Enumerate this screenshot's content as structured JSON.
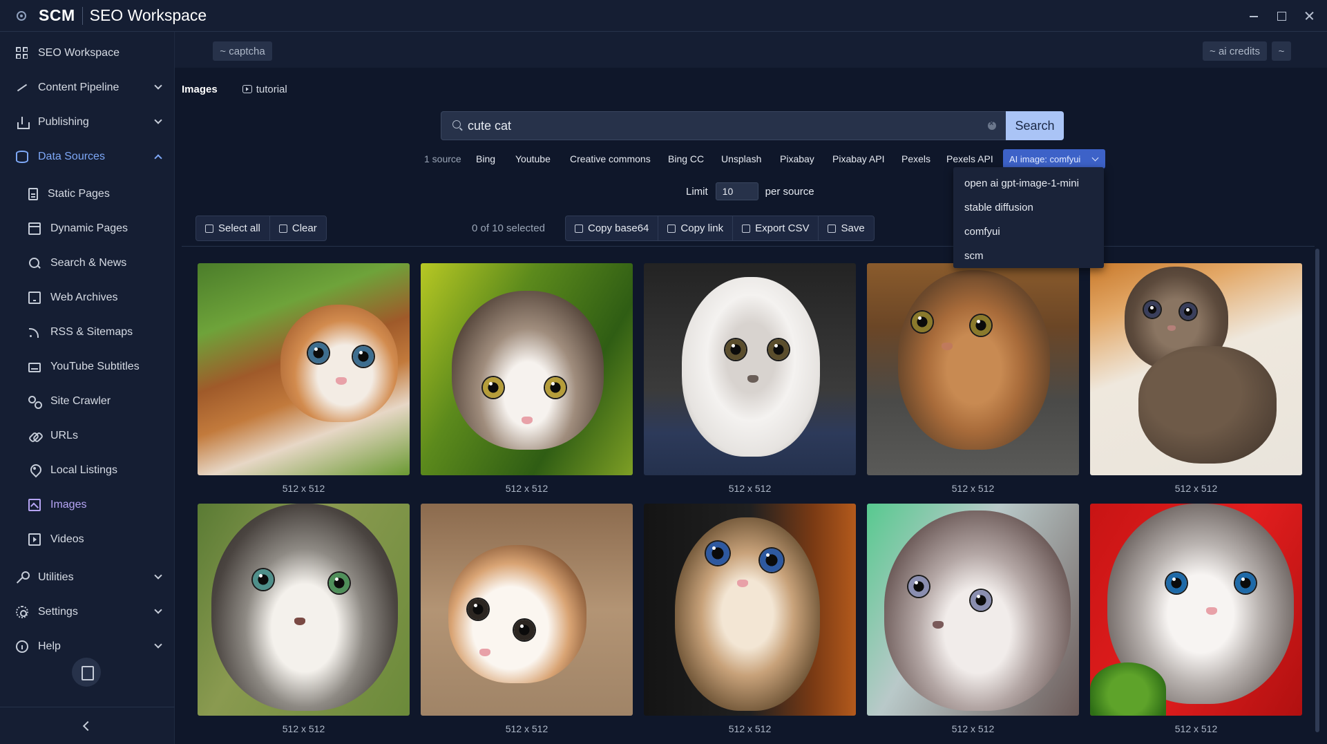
{
  "window": {
    "brand": "SCM",
    "title": "SEO Workspace"
  },
  "sidebar": {
    "items": [
      {
        "label": "SEO Workspace",
        "icon": "grid-icon"
      },
      {
        "label": "Content Pipeline",
        "icon": "pipeline-icon"
      },
      {
        "label": "Publishing",
        "icon": "upload-icon"
      },
      {
        "label": "Data Sources",
        "icon": "database-icon"
      },
      {
        "label": "Static Pages",
        "icon": "document-icon"
      },
      {
        "label": "Dynamic Pages",
        "icon": "window-icon"
      },
      {
        "label": "Search & News",
        "icon": "search-icon"
      },
      {
        "label": "Web Archives",
        "icon": "archive-icon"
      },
      {
        "label": "RSS & Sitemaps",
        "icon": "rss-icon"
      },
      {
        "label": "YouTube Subtitles",
        "icon": "subtitles-icon"
      },
      {
        "label": "Site Crawler",
        "icon": "crawler-icon"
      },
      {
        "label": "URLs",
        "icon": "link-icon"
      },
      {
        "label": "Local Listings",
        "icon": "location-pin-icon"
      },
      {
        "label": "Images",
        "icon": "image-icon"
      },
      {
        "label": "Videos",
        "icon": "video-icon"
      },
      {
        "label": "Utilities",
        "icon": "wrench-icon"
      },
      {
        "label": "Settings",
        "icon": "gear-icon"
      },
      {
        "label": "Help",
        "icon": "info-icon"
      }
    ]
  },
  "topbar": {
    "captcha": "~ captcha",
    "ai_credits": "~ ai credits",
    "tilde": "~"
  },
  "tabs": {
    "images": "Images",
    "tutorial": "tutorial"
  },
  "search": {
    "query": "cute cat",
    "button": "Search"
  },
  "sources": {
    "count_label": "1 source",
    "items": [
      "Bing",
      "Youtube",
      "Creative commons",
      "Bing CC",
      "Unsplash",
      "Pixabay",
      "Pixabay API",
      "Pexels",
      "Pexels API"
    ],
    "ai_selected": "AI image: comfyui"
  },
  "ai_dropdown": {
    "options": [
      "open ai gpt-image-1-mini",
      "stable diffusion",
      "comfyui",
      "scm"
    ]
  },
  "limit": {
    "label": "Limit",
    "value": "10",
    "suffix": "per source"
  },
  "toolbar": {
    "select_all": "Select all",
    "clear": "Clear",
    "selected_count": "0 of 10 selected",
    "copy_base64": "Copy base64",
    "copy_link": "Copy link",
    "export_csv": "Export CSV",
    "save": "Save"
  },
  "results": [
    {
      "size": "512 x 512"
    },
    {
      "size": "512 x 512"
    },
    {
      "size": "512 x 512"
    },
    {
      "size": "512 x 512"
    },
    {
      "size": "512 x 512"
    },
    {
      "size": "512 x 512"
    },
    {
      "size": "512 x 512"
    },
    {
      "size": "512 x 512"
    },
    {
      "size": "512 x 512"
    },
    {
      "size": "512 x 512"
    }
  ],
  "colors": {
    "accent": "#3d62c8",
    "search_button": "#aac4f6",
    "active_nav": "#b6a5f5",
    "active_group": "#7ea8f7"
  }
}
